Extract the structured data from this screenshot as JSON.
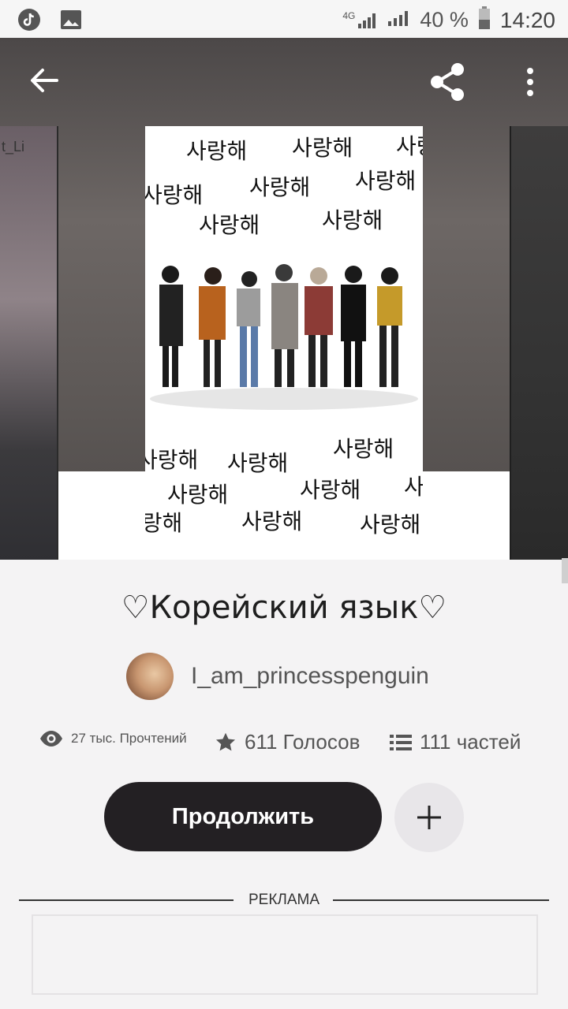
{
  "status_bar": {
    "network": "4G",
    "battery": "40 %",
    "time": "14:20"
  },
  "cover": {
    "korean_text": "사랑해"
  },
  "story": {
    "title": "♡Корейский язык♡",
    "author": "I_am_princesspenguin",
    "reads": "27 тыс. Прочтений",
    "votes": "611 Голосов",
    "parts": "111 частей"
  },
  "actions": {
    "continue_label": "Продолжить"
  },
  "ad": {
    "label": "РЕКЛАМА"
  },
  "side_cover_text": "t_Li",
  "colors": {
    "primary_button": "#232023",
    "background": "#f4f3f4"
  }
}
